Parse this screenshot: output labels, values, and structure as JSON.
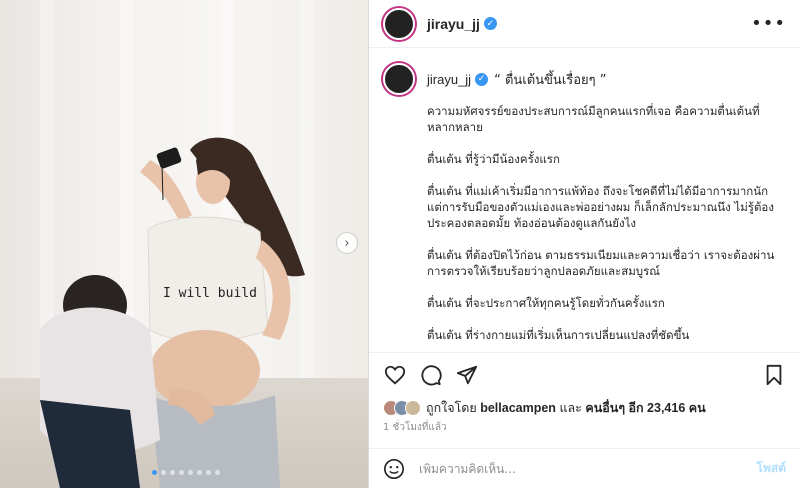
{
  "post": {
    "username": "jirayu_jj",
    "caption_title": "“ ตื่นเต้นขึ้นเรื่อยๆ ”",
    "caption_paragraphs": [
      "ความมหัศจรรย์ของประสบการณ์มีลูกคนแรกที่เจอ คือความตื่นเต้นที่หลากหลาย",
      "ตื่นเต้น ที่รู้ว่ามีน้องครั้งแรก",
      "ตื่นเต้น ที่แม่เค้าเริ่มมีอาการแพ้ท้อง ถึงจะโชคดีที่ไม่ได้มีอาการมากนัก แต่การรับมือของตัวแม่เองและพ่ออย่างผม ก็เล็กลักประมาณนึง ไม่รู้ต้องประคองตลอดมั้ย ท้องอ่อนต้องดูแลกันยังไง",
      "ตื่นเต้น ที่ต้องปิดไว้ก่อน ตามธรรมเนียมและความเชื่อว่า เราจะต้องผ่านการตรวจให้เรียบร้อยว่าลูกปลอดภัยและสมบูรณ์",
      "ตื่นเต้น ที่จะประกาศให้ทุกคนรู้โดยทั่วกันครั้งแรก",
      "ตื่นเต้น ที่ร่างกายแม่ที่เริ่มเห็นการเปลี่ยนแปลงที่ชัดขึ้น"
    ],
    "shirt_text": "I will build",
    "likes_prefix": "ถูกใจโดย",
    "liked_by": "bellacampen",
    "likes_and": "และ",
    "likes_others": "คนอื่นๆ อีก 23,416 คน",
    "time_ago": "1 ชั่วโมงที่แล้ว",
    "comment_placeholder": "เพิ่มความคิดเห็น...",
    "post_label": "โพสต์",
    "carousel": {
      "total": 8,
      "current": 1
    }
  },
  "icons": {
    "more": "more-options-icon",
    "verified": "verified-badge-icon",
    "like": "heart-icon",
    "comment": "comment-icon",
    "share": "share-icon",
    "save": "bookmark-icon",
    "emoji": "emoji-icon",
    "next": "chevron-right-icon"
  },
  "colors": {
    "accent": "#3897f0",
    "story_ring": "#c13584",
    "post_button": "#b2dffc",
    "secondary_text": "#8e8e8e"
  }
}
